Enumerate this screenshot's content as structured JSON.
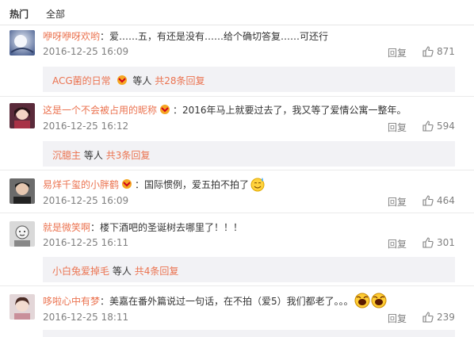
{
  "tabs": [
    {
      "label": "热门"
    },
    {
      "label": "全部"
    }
  ],
  "comments": [
    {
      "username": "咿呀咿呀欢哟",
      "text": "：爱……五，有还是没有……给个确切答复……可还行",
      "time": "2016-12-25 16:09",
      "reply": "回复",
      "likes": "871",
      "sub": {
        "user": "ACG菌的日常",
        "middle": "等人",
        "count": "共28条回复"
      }
    },
    {
      "username": "这是一个不会被占用的昵称",
      "text": "：2016年马上就要过去了，我又等了爱情公寓一整年。",
      "time": "2016-12-25 16:12",
      "reply": "回复",
      "likes": "594",
      "sub": {
        "user": "沉臆主",
        "middle": "等人",
        "count": "共3条回复"
      }
    },
    {
      "username": "易烊千玺的小胖鹤",
      "text": "：国际惯例，爱五拍不拍了",
      "time": "2016-12-25 16:09",
      "reply": "回复",
      "likes": "464"
    },
    {
      "username": "就是微笑啊",
      "text": "：楼下酒吧的圣诞树去哪里了！！！",
      "time": "2016-12-25 16:11",
      "reply": "回复",
      "likes": "301",
      "sub": {
        "user": "小白兔爱掉毛",
        "middle": "等人",
        "count": "共4条回复"
      }
    },
    {
      "username": "哆啦心中有梦",
      "text": "：美嘉在番外篇说过一句话，在不拍（爱5）我们都老了。。。",
      "time": "2016-12-25 18:11",
      "reply": "回复",
      "likes": "239"
    }
  ],
  "colors": {
    "username": "#eb7350",
    "meta": "#808080",
    "subbox": "#f2f2f5"
  }
}
